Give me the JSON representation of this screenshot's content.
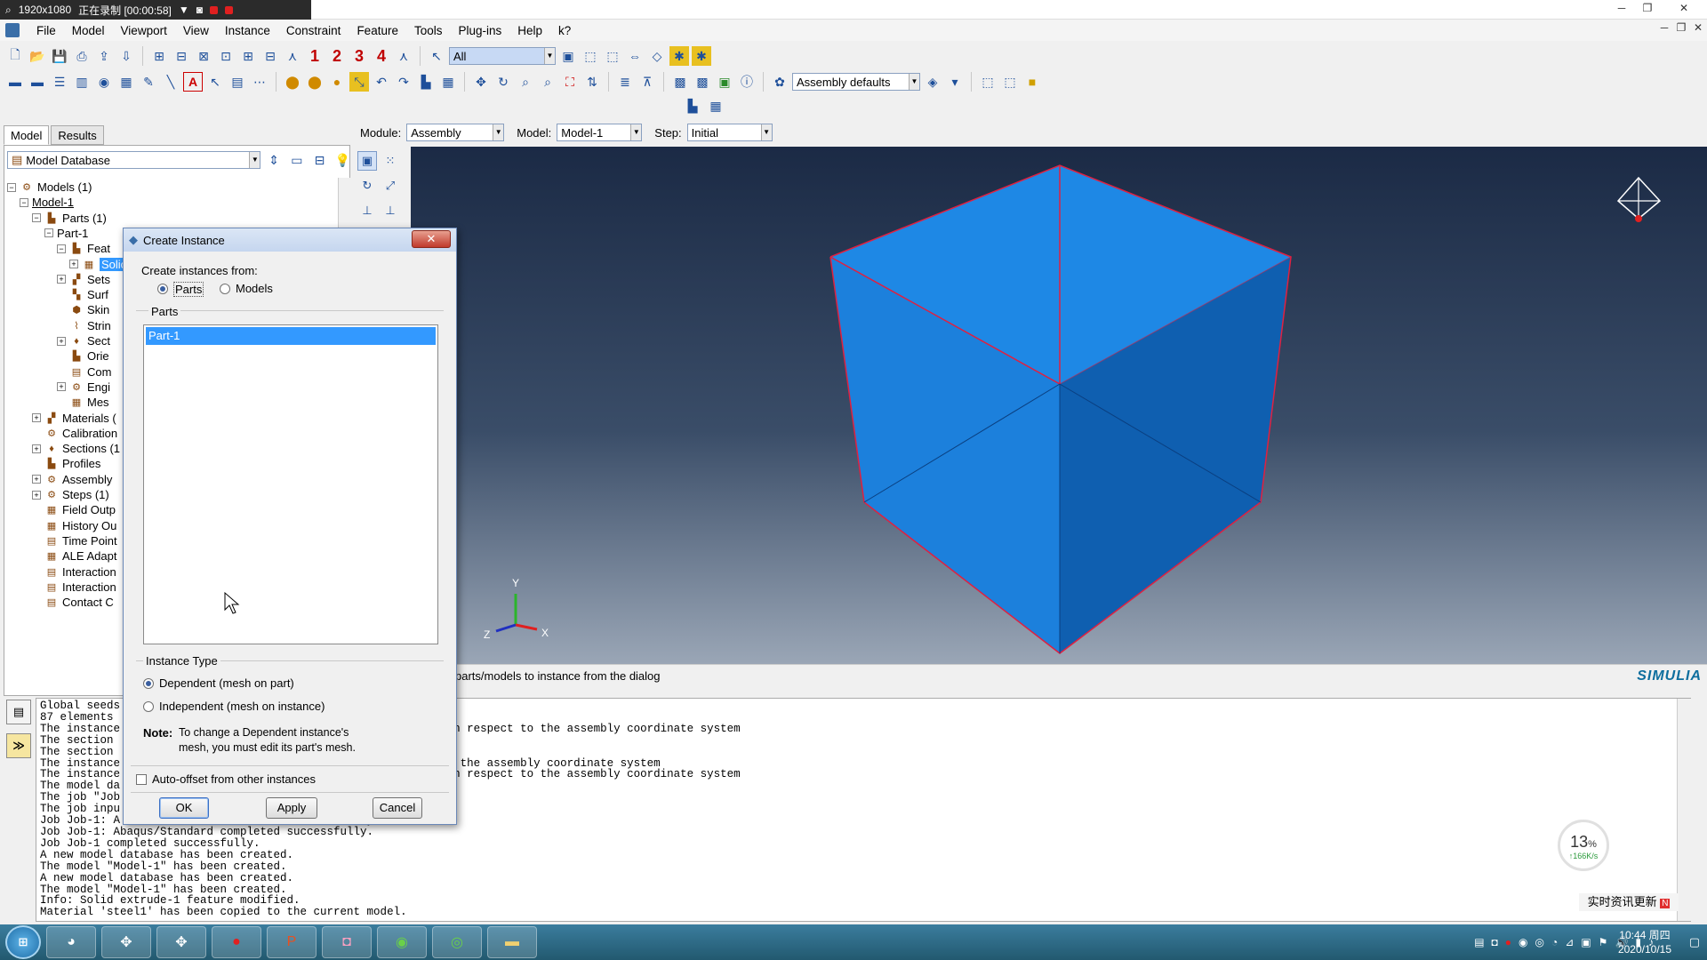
{
  "recorder": {
    "resolution": "1920x1080",
    "status": "正在录制 [00:00:58]"
  },
  "menu": [
    "File",
    "Model",
    "Viewport",
    "View",
    "Instance",
    "Constraint",
    "Feature",
    "Tools",
    "Plug-ins",
    "Help",
    "k?"
  ],
  "toolbar1": {
    "numbers": [
      "1",
      "2",
      "3",
      "4"
    ],
    "selection_filter": "All"
  },
  "toolbar2": {
    "render_style": "Assembly defaults"
  },
  "context": {
    "module_label": "Module:",
    "module_value": "Assembly",
    "model_label": "Model:",
    "model_value": "Model-1",
    "step_label": "Step:",
    "step_value": "Initial"
  },
  "left_tabs": [
    "Model",
    "Results"
  ],
  "model_db": "Model Database",
  "tree": [
    {
      "label": "Models (1)"
    },
    {
      "label": "Model-1"
    },
    {
      "label": "Parts (1)"
    },
    {
      "label": "Part-1"
    },
    {
      "label": "Feat"
    },
    {
      "label": "Solic"
    },
    {
      "label": "Sets"
    },
    {
      "label": "Surf"
    },
    {
      "label": "Skin"
    },
    {
      "label": "Strin"
    },
    {
      "label": "Sect"
    },
    {
      "label": "Orie"
    },
    {
      "label": "Com"
    },
    {
      "label": "Engi"
    },
    {
      "label": "Mes"
    },
    {
      "label": "Materials ("
    },
    {
      "label": "Calibration"
    },
    {
      "label": "Sections (1"
    },
    {
      "label": "Profiles"
    },
    {
      "label": "Assembly"
    },
    {
      "label": "Steps (1)"
    },
    {
      "label": "Field Outp"
    },
    {
      "label": "History Ou"
    },
    {
      "label": "Time Point"
    },
    {
      "label": "ALE Adapt"
    },
    {
      "label": "Interaction"
    },
    {
      "label": "Interaction"
    },
    {
      "label": "Contact C"
    }
  ],
  "dialog": {
    "title": "Create Instance",
    "create_from_label": "Create instances from:",
    "opt_parts": "Parts",
    "opt_models": "Models",
    "parts_group": "Parts",
    "parts_list": [
      "Part-1"
    ],
    "instance_type_label": "Instance Type",
    "opt_dependent": "Dependent (mesh on part)",
    "opt_independent": "Independent (mesh on instance)",
    "note_label": "Note:",
    "note_line1": "To change a Dependent instance's",
    "note_line2": "mesh, you must edit its part's mesh.",
    "auto_offset": "Auto-offset from other instances",
    "ok": "OK",
    "apply": "Apply",
    "cancel": "Cancel"
  },
  "prompt": "parts/models to instance from the dialog",
  "brand": "SIMULIA",
  "triad": {
    "y": "Y",
    "x": "X",
    "z": "Z"
  },
  "messages": [
    "Global seeds",
    "87 elements",
    "The instance                                  1.721169, 0. with respect to the assembly coordinate system",
    "The section                                   achment line.",
    "The section                                   achment line.",
    "The instance                                   with respect to the assembly coordinate system",
    "The instance                                  1.721169, 0. with respect to the assembly coordinate system",
    "The model da                                  ae\".",
    "The job \"Job",
    "The job inpu                                  sis.",
    "Job Job-1: A                                  ully.",
    "Job Job-1: Abaqus/Standard completed successfully.",
    "Job Job-1 completed successfully.",
    "A new model database has been created.",
    "The model \"Model-1\" has been created.",
    "A new model database has been created.",
    "The model \"Model-1\" has been created.",
    "Info: Solid extrude-1 feature modified.",
    "Material 'steel1' has been copied to the current model."
  ],
  "net_widget": {
    "percent": "13",
    "unit": "%",
    "speed": "↑166K/s"
  },
  "news": "实时资讯更新",
  "clock": {
    "time": "10:44 周四",
    "date": "2020/10/15"
  },
  "colors": {
    "cube_light": "#1e88e5",
    "cube_dark": "#0d5fb0",
    "edge": "#e02040",
    "selection": "#3399ff"
  }
}
